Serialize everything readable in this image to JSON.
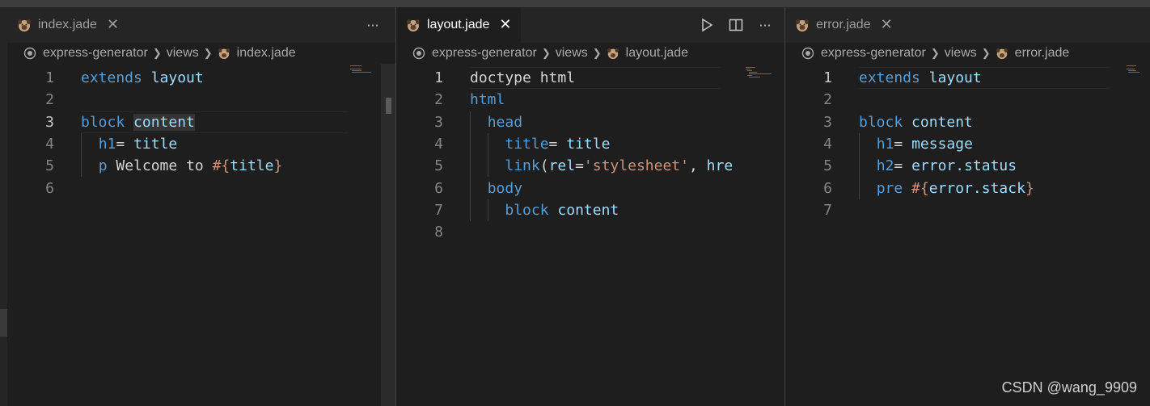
{
  "editors": [
    {
      "tab": {
        "label": "index.jade",
        "close": "✕",
        "active": false
      },
      "actions": [
        {
          "name": "more-actions",
          "glyph": "···"
        }
      ],
      "breadcrumb": {
        "folder": "express-generator",
        "sub": "views",
        "file": "index.jade"
      },
      "lines": [
        {
          "num": "1",
          "tokens": [
            {
              "t": "extends",
              "c": "kw"
            },
            {
              "t": " "
            },
            {
              "t": "layout",
              "c": "id"
            }
          ]
        },
        {
          "num": "2",
          "tokens": []
        },
        {
          "num": "3",
          "tokens": [
            {
              "t": "block",
              "c": "kw"
            },
            {
              "t": " "
            },
            {
              "t": "content",
              "c": "id"
            }
          ]
        },
        {
          "num": "4",
          "tokens": [
            {
              "t": "  "
            },
            {
              "t": "h1",
              "c": "kw"
            },
            {
              "t": "= "
            },
            {
              "t": "title",
              "c": "id"
            }
          ]
        },
        {
          "num": "5",
          "tokens": [
            {
              "t": "  "
            },
            {
              "t": "p",
              "c": "kw"
            },
            {
              "t": " Welcome to "
            },
            {
              "t": "#{",
              "c": "str"
            },
            {
              "t": "title",
              "c": "id"
            },
            {
              "t": "}",
              "c": "str"
            }
          ]
        },
        {
          "num": "6",
          "tokens": []
        }
      ],
      "current_line": "3"
    },
    {
      "tab": {
        "label": "layout.jade",
        "close": "✕",
        "active": true
      },
      "actions": [
        {
          "name": "run",
          "glyph": "▷"
        },
        {
          "name": "split-editor",
          "glyph": "◫"
        },
        {
          "name": "more-actions",
          "glyph": "···"
        }
      ],
      "breadcrumb": {
        "folder": "express-generator",
        "sub": "views",
        "file": "layout.jade"
      },
      "lines": [
        {
          "num": "1",
          "tokens": [
            {
              "t": "doctype html",
              "c": "txt"
            }
          ]
        },
        {
          "num": "2",
          "tokens": [
            {
              "t": "html",
              "c": "kw"
            }
          ]
        },
        {
          "num": "3",
          "tokens": [
            {
              "t": "  "
            },
            {
              "t": "head",
              "c": "kw"
            }
          ]
        },
        {
          "num": "4",
          "tokens": [
            {
              "t": "    "
            },
            {
              "t": "title",
              "c": "kw"
            },
            {
              "t": "= "
            },
            {
              "t": "title",
              "c": "id"
            }
          ]
        },
        {
          "num": "5",
          "tokens": [
            {
              "t": "    "
            },
            {
              "t": "link",
              "c": "kw"
            },
            {
              "t": "("
            },
            {
              "t": "rel",
              "c": "id"
            },
            {
              "t": "="
            },
            {
              "t": "'stylesheet'",
              "c": "str"
            },
            {
              "t": ", "
            },
            {
              "t": "hre",
              "c": "id"
            }
          ]
        },
        {
          "num": "6",
          "tokens": [
            {
              "t": "  "
            },
            {
              "t": "body",
              "c": "kw"
            }
          ]
        },
        {
          "num": "7",
          "tokens": [
            {
              "t": "    "
            },
            {
              "t": "block",
              "c": "kw"
            },
            {
              "t": " "
            },
            {
              "t": "content",
              "c": "id"
            }
          ]
        },
        {
          "num": "8",
          "tokens": []
        }
      ],
      "current_line": "1"
    },
    {
      "tab": {
        "label": "error.jade",
        "close": "✕",
        "active": false
      },
      "actions": [],
      "breadcrumb": {
        "folder": "express-generator",
        "sub": "views",
        "file": "error.jade"
      },
      "lines": [
        {
          "num": "1",
          "tokens": [
            {
              "t": "extends",
              "c": "kw"
            },
            {
              "t": " "
            },
            {
              "t": "layout",
              "c": "id"
            }
          ]
        },
        {
          "num": "2",
          "tokens": []
        },
        {
          "num": "3",
          "tokens": [
            {
              "t": "block",
              "c": "kw"
            },
            {
              "t": " "
            },
            {
              "t": "content",
              "c": "id"
            }
          ]
        },
        {
          "num": "4",
          "tokens": [
            {
              "t": "  "
            },
            {
              "t": "h1",
              "c": "kw"
            },
            {
              "t": "= "
            },
            {
              "t": "message",
              "c": "id"
            }
          ]
        },
        {
          "num": "5",
          "tokens": [
            {
              "t": "  "
            },
            {
              "t": "h2",
              "c": "kw"
            },
            {
              "t": "= "
            },
            {
              "t": "error.status",
              "c": "id"
            }
          ]
        },
        {
          "num": "6",
          "tokens": [
            {
              "t": "  "
            },
            {
              "t": "pre",
              "c": "kw"
            },
            {
              "t": " "
            },
            {
              "t": "#{",
              "c": "str"
            },
            {
              "t": "error.stack",
              "c": "id"
            },
            {
              "t": "}",
              "c": "str"
            }
          ]
        },
        {
          "num": "7",
          "tokens": []
        }
      ],
      "current_line": "1"
    }
  ],
  "watermark": "CSDN @wang_9909",
  "colors": {
    "keyword": "#569cd6",
    "identifier": "#9cdcfe",
    "string": "#ce9178",
    "text": "#d4d4d4",
    "background": "#1e1e1e"
  },
  "icons": {
    "file": "pug-icon",
    "breadcrumb_root": "target-icon"
  }
}
